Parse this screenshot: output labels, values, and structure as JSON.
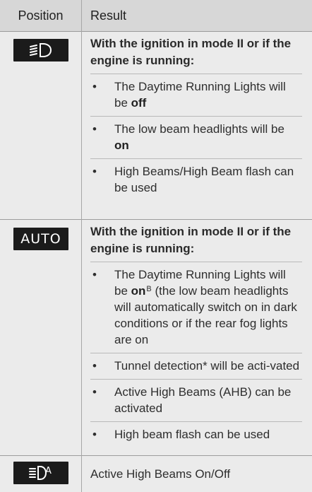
{
  "header": {
    "position": "Position",
    "result": "Result"
  },
  "rows": [
    {
      "icon": "low-beam-icon",
      "lead": "With the ignition in mode II or if the engine is running:",
      "items": [
        {
          "pre": "The Daytime Running Lights will be ",
          "bold": "off",
          "post": ""
        },
        {
          "pre": "The low beam headlights will be ",
          "bold": "on",
          "post": ""
        },
        {
          "pre": "High Beams/High Beam flash can be used",
          "bold": "",
          "post": ""
        }
      ]
    },
    {
      "icon": "auto-icon",
      "badge_text": "AUTO",
      "lead": "With the ignition in mode II or if the engine is running:",
      "items": [
        {
          "pre": "The Daytime Running Lights will be ",
          "bold": "on",
          "sup": "B",
          "post": " (the low beam headlights will automatically switch on in dark conditions or if the rear fog lights are on"
        },
        {
          "pre": "Tunnel detection* will be acti-vated",
          "bold": "",
          "post": ""
        },
        {
          "pre": "Active High Beams (AHB) can be activated",
          "bold": "",
          "post": ""
        },
        {
          "pre": "High beam flash can be used",
          "bold": "",
          "post": ""
        }
      ]
    },
    {
      "icon": "active-high-beam-icon",
      "text": "Active High Beams On/Off"
    }
  ],
  "bullet": "•",
  "colors": {
    "header_bg": "#d7d7d7",
    "row_bg": "#ebebeb",
    "badge_bg": "#1b1b1b"
  }
}
